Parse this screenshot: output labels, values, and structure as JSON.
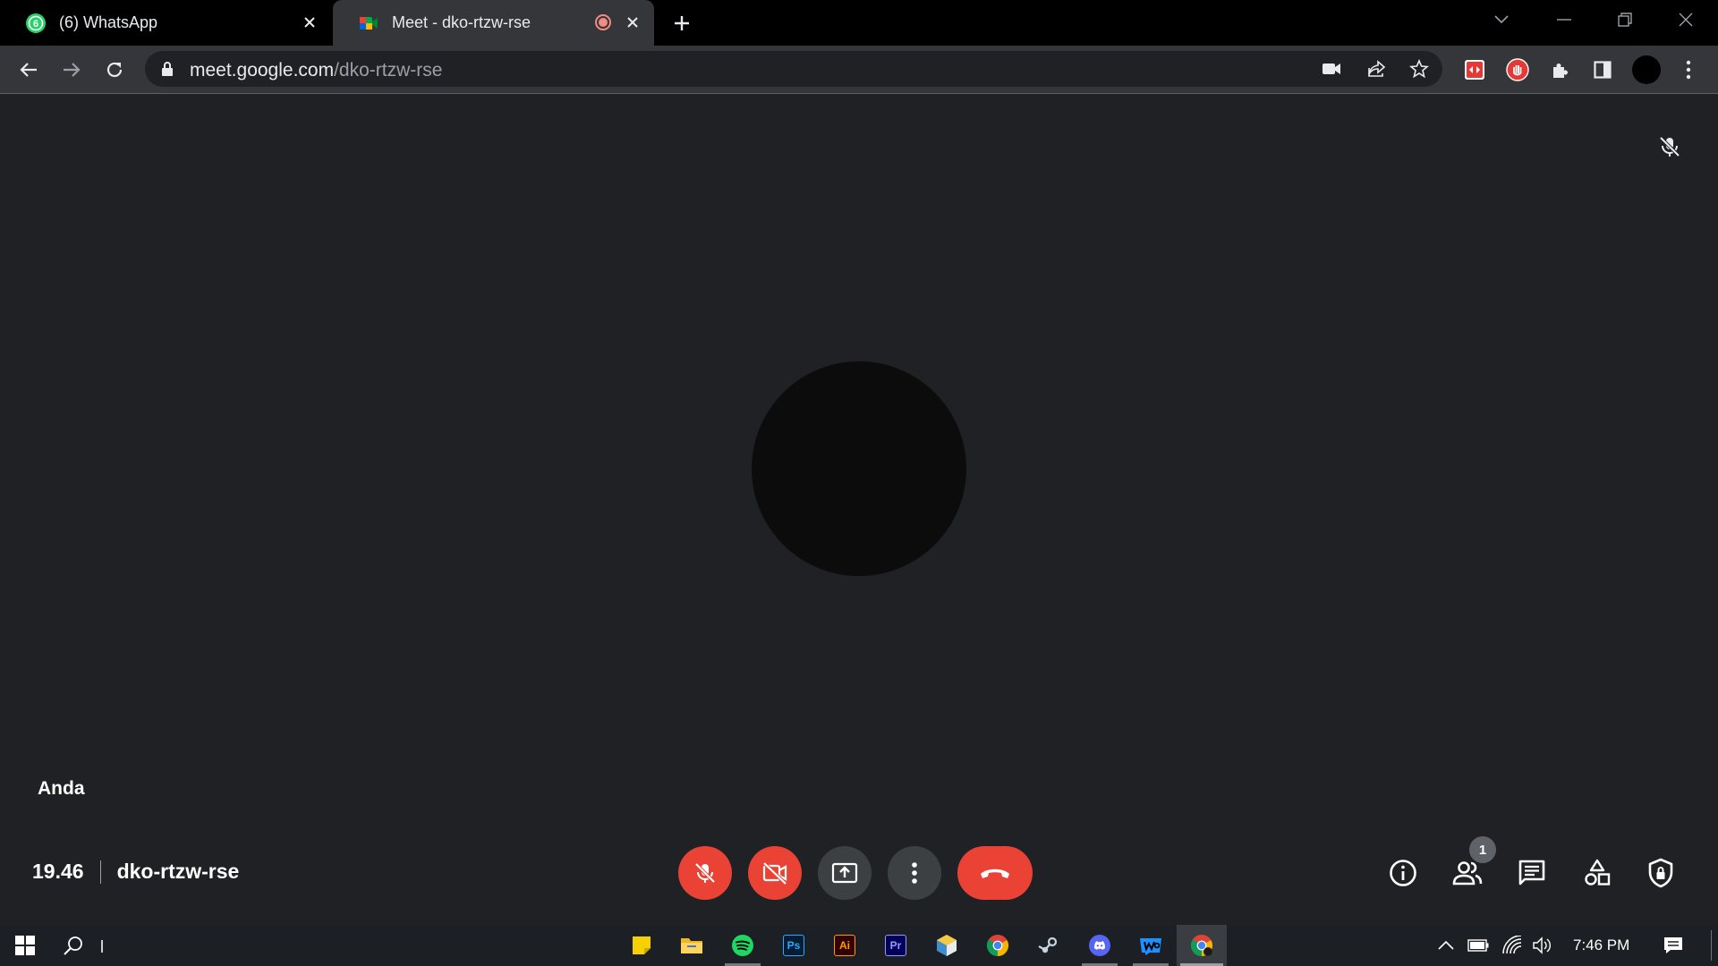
{
  "browser": {
    "tabs": [
      {
        "title": "(6) WhatsApp",
        "favicon": "whatsapp-icon",
        "badge": "6",
        "active": false
      },
      {
        "title": "Meet - dko-rtzw-rse",
        "favicon": "google-meet-icon",
        "recording": true,
        "active": true
      }
    ],
    "address": {
      "domain": "meet.google.com",
      "path": "/dko-rtzw-rse"
    },
    "accent": "#ea4335"
  },
  "meet": {
    "participant_name": "Anda",
    "time": "19.46",
    "meeting_code": "dko-rtzw-rse",
    "people_count": "1",
    "controls": {
      "mic": "mic-off-icon",
      "camera": "camera-off-icon",
      "present": "present-screen-icon",
      "more": "more-options-icon",
      "leave": "end-call-icon"
    },
    "side_controls": [
      "info-icon",
      "people-icon",
      "chat-icon",
      "activities-icon",
      "host-controls-icon"
    ]
  },
  "taskbar": {
    "apps": [
      "sticky-notes",
      "file-explorer",
      "spotify",
      "photoshop",
      "illustrator",
      "premiere-pro",
      "app",
      "chrome",
      "steam",
      "discord",
      "webtoon",
      "chrome-active"
    ],
    "app_labels": {
      "photoshop": "Ps",
      "illustrator": "Ai",
      "premiere": "Pr"
    },
    "clock": "7:46 PM"
  }
}
